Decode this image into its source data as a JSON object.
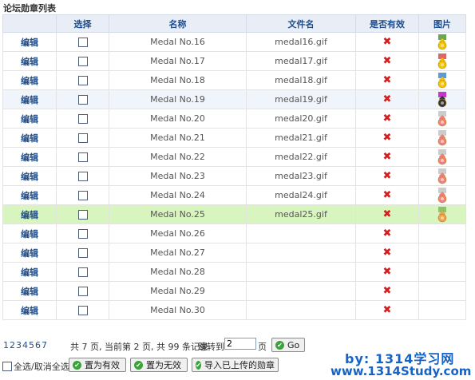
{
  "title": "论坛勋章列表",
  "columns": {
    "edit": "",
    "select": "选择",
    "name": "名称",
    "file": "文件名",
    "valid": "是否有效",
    "image": "图片"
  },
  "rows": [
    {
      "edit": "编辑",
      "name": "Medal No.16",
      "file": "medal16.gif",
      "valid": "✖",
      "image": "medal-16-icon"
    },
    {
      "edit": "编辑",
      "name": "Medal No.17",
      "file": "medal17.gif",
      "valid": "✖",
      "image": "medal-17-icon"
    },
    {
      "edit": "编辑",
      "name": "Medal No.18",
      "file": "medal18.gif",
      "valid": "✖",
      "image": "medal-18-icon"
    },
    {
      "edit": "编辑",
      "name": "Medal No.19",
      "file": "medal19.gif",
      "valid": "✖",
      "image": "medal-19-icon"
    },
    {
      "edit": "编辑",
      "name": "Medal No.20",
      "file": "medal20.gif",
      "valid": "✖",
      "image": "medal-20-icon"
    },
    {
      "edit": "编辑",
      "name": "Medal No.21",
      "file": "medal21.gif",
      "valid": "✖",
      "image": "medal-21-icon"
    },
    {
      "edit": "编辑",
      "name": "Medal No.22",
      "file": "medal22.gif",
      "valid": "✖",
      "image": "medal-22-icon"
    },
    {
      "edit": "编辑",
      "name": "Medal No.23",
      "file": "medal23.gif",
      "valid": "✖",
      "image": "medal-23-icon"
    },
    {
      "edit": "编辑",
      "name": "Medal No.24",
      "file": "medal24.gif",
      "valid": "✖",
      "image": "medal-24-icon"
    },
    {
      "edit": "编辑",
      "name": "Medal No.25",
      "file": "medal25.gif",
      "valid": "✖",
      "image": "medal-25-icon"
    },
    {
      "edit": "编辑",
      "name": "Medal No.26",
      "file": "",
      "valid": "✖",
      "image": ""
    },
    {
      "edit": "编辑",
      "name": "Medal No.27",
      "file": "",
      "valid": "✖",
      "image": ""
    },
    {
      "edit": "编辑",
      "name": "Medal No.28",
      "file": "",
      "valid": "✖",
      "image": ""
    },
    {
      "edit": "编辑",
      "name": "Medal No.29",
      "file": "",
      "valid": "✖",
      "image": ""
    },
    {
      "edit": "编辑",
      "name": "Medal No.30",
      "file": "",
      "valid": "✖",
      "image": ""
    }
  ],
  "pager": {
    "pages": [
      "1",
      "2",
      "3",
      "4",
      "5",
      "6",
      "7"
    ],
    "info": "共 7 页, 当前第 2 页, 共 99 条记录",
    "jump_label": "跳转到:",
    "jump_value": "2",
    "page_unit": "页",
    "go_label": "Go"
  },
  "actions": {
    "select_all": "全选/取消全选",
    "set_valid": "置为有效",
    "set_invalid": "置为无效",
    "import": "导入已上传的勋章"
  },
  "watermark": {
    "line1": "by: 1314学习网",
    "line2": "www.1314Study.com"
  },
  "colors": {
    "header_text": "#1f4d8a",
    "invalid": "#d21f1f",
    "highlight_row": "#d8f5c0",
    "watermark": "#1563c6"
  }
}
